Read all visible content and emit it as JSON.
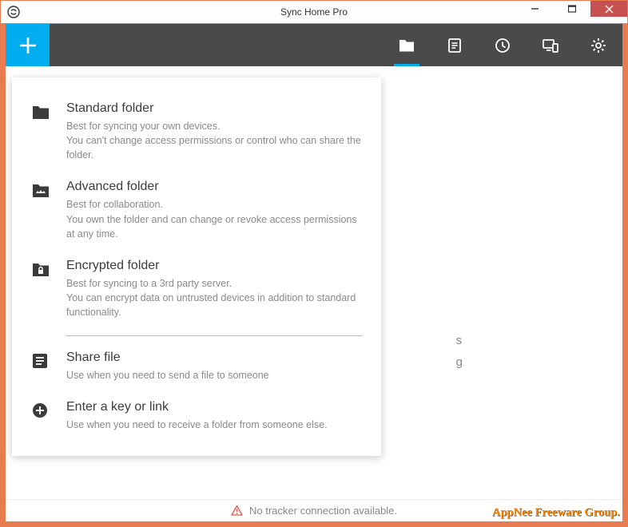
{
  "window": {
    "title": "Sync Home Pro"
  },
  "dropdown": {
    "items": [
      {
        "title": "Standard folder",
        "desc": "Best for syncing your own devices.\nYou can't change access permissions or control who can share the folder."
      },
      {
        "title": "Advanced folder",
        "desc": "Best for collaboration.\nYou own the folder and can change or revoke access permissions at any time."
      },
      {
        "title": "Encrypted folder",
        "desc": "Best for syncing to a 3rd party server.\nYou can encrypt data on untrusted devices in addition to standard functionality."
      },
      {
        "title": "Share file",
        "desc": "Use when you need to send a file to someone"
      },
      {
        "title": "Enter a key or link",
        "desc": "Use when you need to receive a folder from someone else."
      }
    ]
  },
  "background_hint": {
    "line1": "s",
    "line2": "g"
  },
  "status": {
    "message": "No tracker connection available."
  },
  "watermark": "AppNee Freeware Group."
}
